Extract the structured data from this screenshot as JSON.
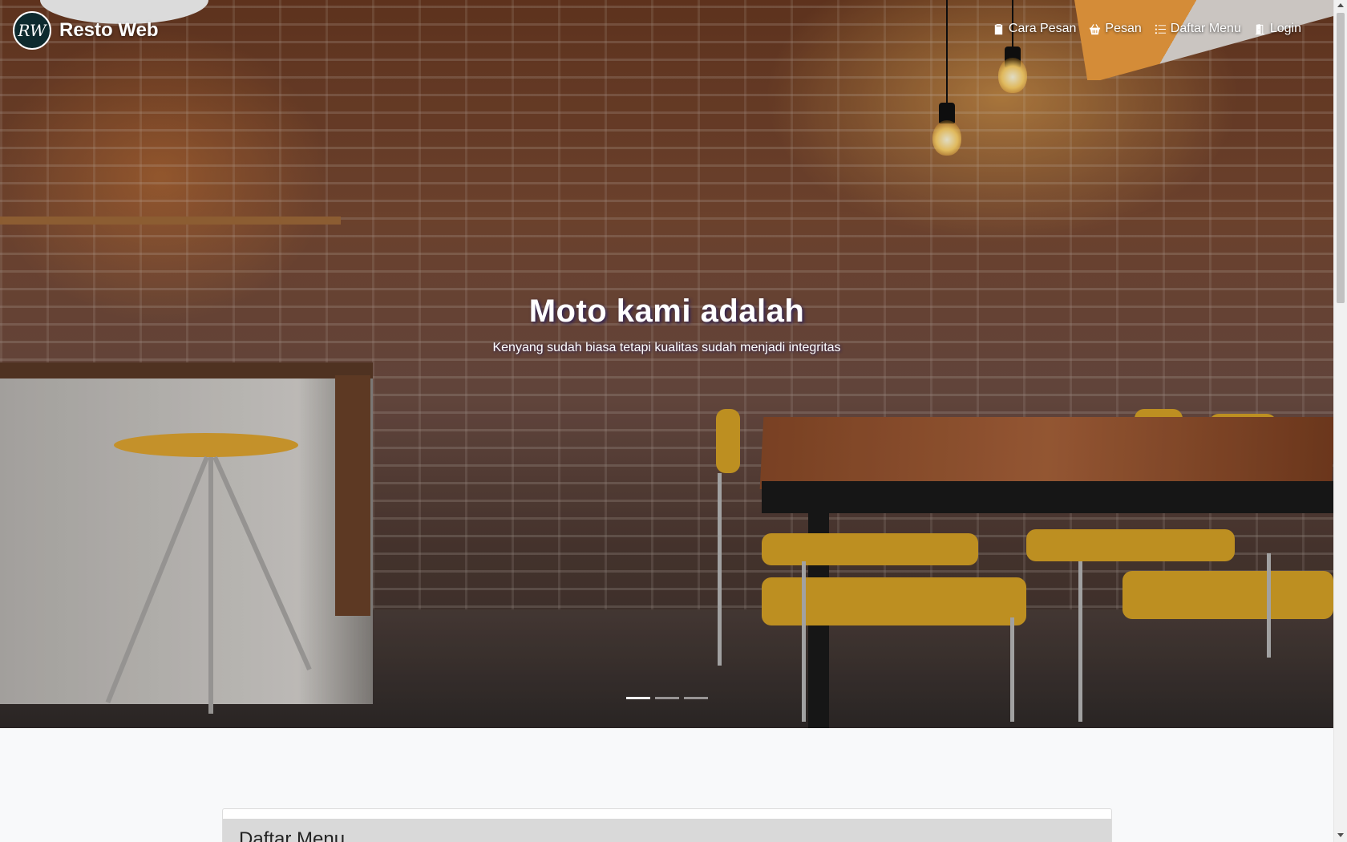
{
  "brand": {
    "logo_text": "RW",
    "name": "Resto Web"
  },
  "nav": {
    "items": [
      {
        "label": "Cara Pesan",
        "icon": "clipboard-icon"
      },
      {
        "label": "Pesan",
        "icon": "basket-icon"
      },
      {
        "label": "Daftar Menu",
        "icon": "list-icon"
      },
      {
        "label": "Login",
        "icon": "door-open-icon"
      }
    ]
  },
  "hero": {
    "title": "Moto kami adalah",
    "subtitle": "Kenyang sudah biasa tetapi kualitas sudah menjadi integritas",
    "slides_count": 3,
    "active_slide": 1
  },
  "menu_section": {
    "title": "Daftar Menu"
  }
}
